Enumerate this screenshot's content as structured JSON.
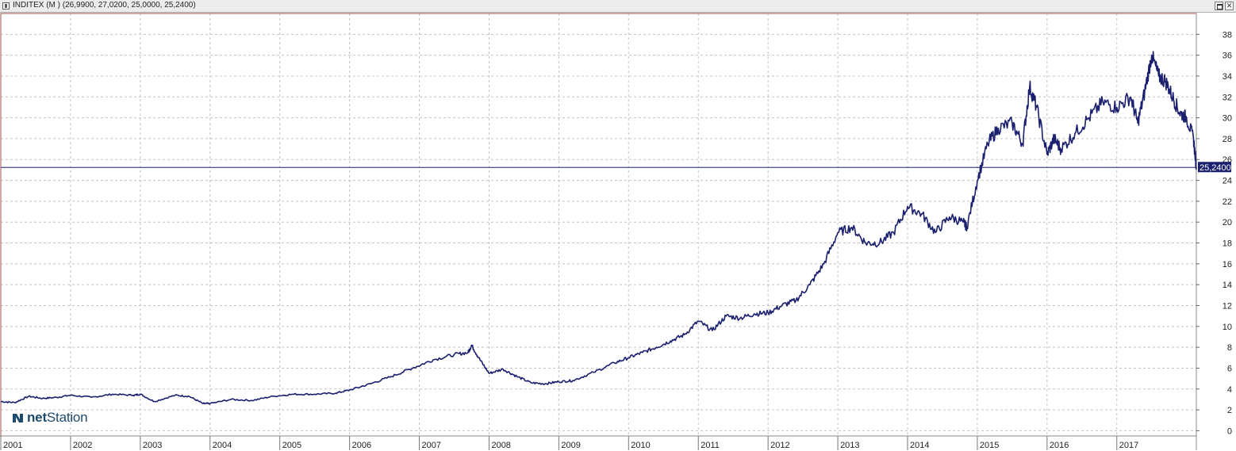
{
  "window": {
    "title": "INDITEX (M ) (26,9900, 27,0200, 25,0000, 25,2400)"
  },
  "brand": {
    "bold": "net",
    "regular": "Station"
  },
  "colors": {
    "line": "#1a1f6e",
    "grid": "#bfbfbf",
    "frame": "#a05050",
    "label_bg": "#1a1f6e"
  },
  "chart_data": {
    "type": "line",
    "title": "",
    "xlabel": "",
    "ylabel": "",
    "x_ticks": [
      "2001",
      "2002",
      "2003",
      "2004",
      "2005",
      "2006",
      "2007",
      "2008",
      "2009",
      "2010",
      "2011",
      "2012",
      "2013",
      "2014",
      "2015",
      "2016",
      "2017"
    ],
    "y_ticks": [
      0,
      2,
      4,
      6,
      8,
      10,
      12,
      14,
      16,
      18,
      20,
      22,
      24,
      26,
      28,
      30,
      32,
      34,
      36,
      38
    ],
    "ylim": [
      -0.5,
      40
    ],
    "xlim": [
      2001.0,
      2018.14
    ],
    "grid": true,
    "last_value": 25.24,
    "last_value_label": "25,2400",
    "series": [
      {
        "x": [
          2001.0,
          2001.2,
          2001.4,
          2001.6,
          2001.8,
          2002.0,
          2002.3,
          2002.6,
          2002.9,
          2003.0,
          2003.2,
          2003.5,
          2003.7,
          2003.9,
          2004.0,
          2004.3,
          2004.6,
          2004.9,
          2005.2,
          2005.5,
          2005.8,
          2006.0,
          2006.3,
          2006.6,
          2006.9,
          2007.2,
          2007.5,
          2007.7,
          2007.75,
          2007.85,
          2008.0,
          2008.2,
          2008.4,
          2008.6,
          2008.8,
          2009.0,
          2009.2,
          2009.5,
          2009.8,
          2010.0,
          2010.2,
          2010.4,
          2010.6,
          2010.8,
          2011.0,
          2011.2,
          2011.4,
          2011.6,
          2011.8,
          2012.0,
          2012.2,
          2012.4,
          2012.6,
          2012.8,
          2013.0,
          2013.2,
          2013.4,
          2013.6,
          2013.8,
          2014.0,
          2014.2,
          2014.4,
          2014.6,
          2014.8,
          2014.85,
          2015.0,
          2015.15,
          2015.3,
          2015.5,
          2015.65,
          2015.75,
          2015.85,
          2016.0,
          2016.1,
          2016.2,
          2016.4,
          2016.6,
          2016.8,
          2017.0,
          2017.2,
          2017.3,
          2017.4,
          2017.5,
          2017.6,
          2017.7,
          2017.8,
          2017.9,
          2018.0,
          2018.1,
          2018.14
        ],
        "y": [
          2.8,
          2.7,
          3.3,
          3.1,
          3.2,
          3.4,
          3.2,
          3.5,
          3.4,
          3.5,
          2.8,
          3.4,
          3.3,
          2.6,
          2.6,
          3.0,
          2.9,
          3.3,
          3.5,
          3.5,
          3.6,
          3.9,
          4.5,
          5.2,
          6.0,
          6.8,
          7.3,
          7.5,
          8.2,
          7.0,
          5.5,
          5.9,
          5.2,
          4.6,
          4.5,
          4.7,
          4.8,
          5.6,
          6.5,
          7.0,
          7.5,
          8.0,
          8.6,
          9.2,
          10.5,
          9.6,
          11.0,
          10.8,
          11.2,
          11.3,
          12.0,
          12.5,
          14.0,
          16.0,
          19.0,
          19.5,
          18.0,
          18.0,
          19.0,
          21.5,
          20.8,
          19.0,
          20.5,
          20.0,
          19.5,
          24.0,
          27.5,
          29.0,
          29.5,
          27.5,
          33.0,
          31.0,
          26.5,
          28.0,
          27.0,
          28.5,
          30.0,
          31.5,
          31.0,
          32.0,
          29.5,
          32.5,
          36.0,
          34.0,
          33.5,
          32.0,
          30.5,
          30.0,
          28.0,
          25.24
        ]
      }
    ]
  }
}
